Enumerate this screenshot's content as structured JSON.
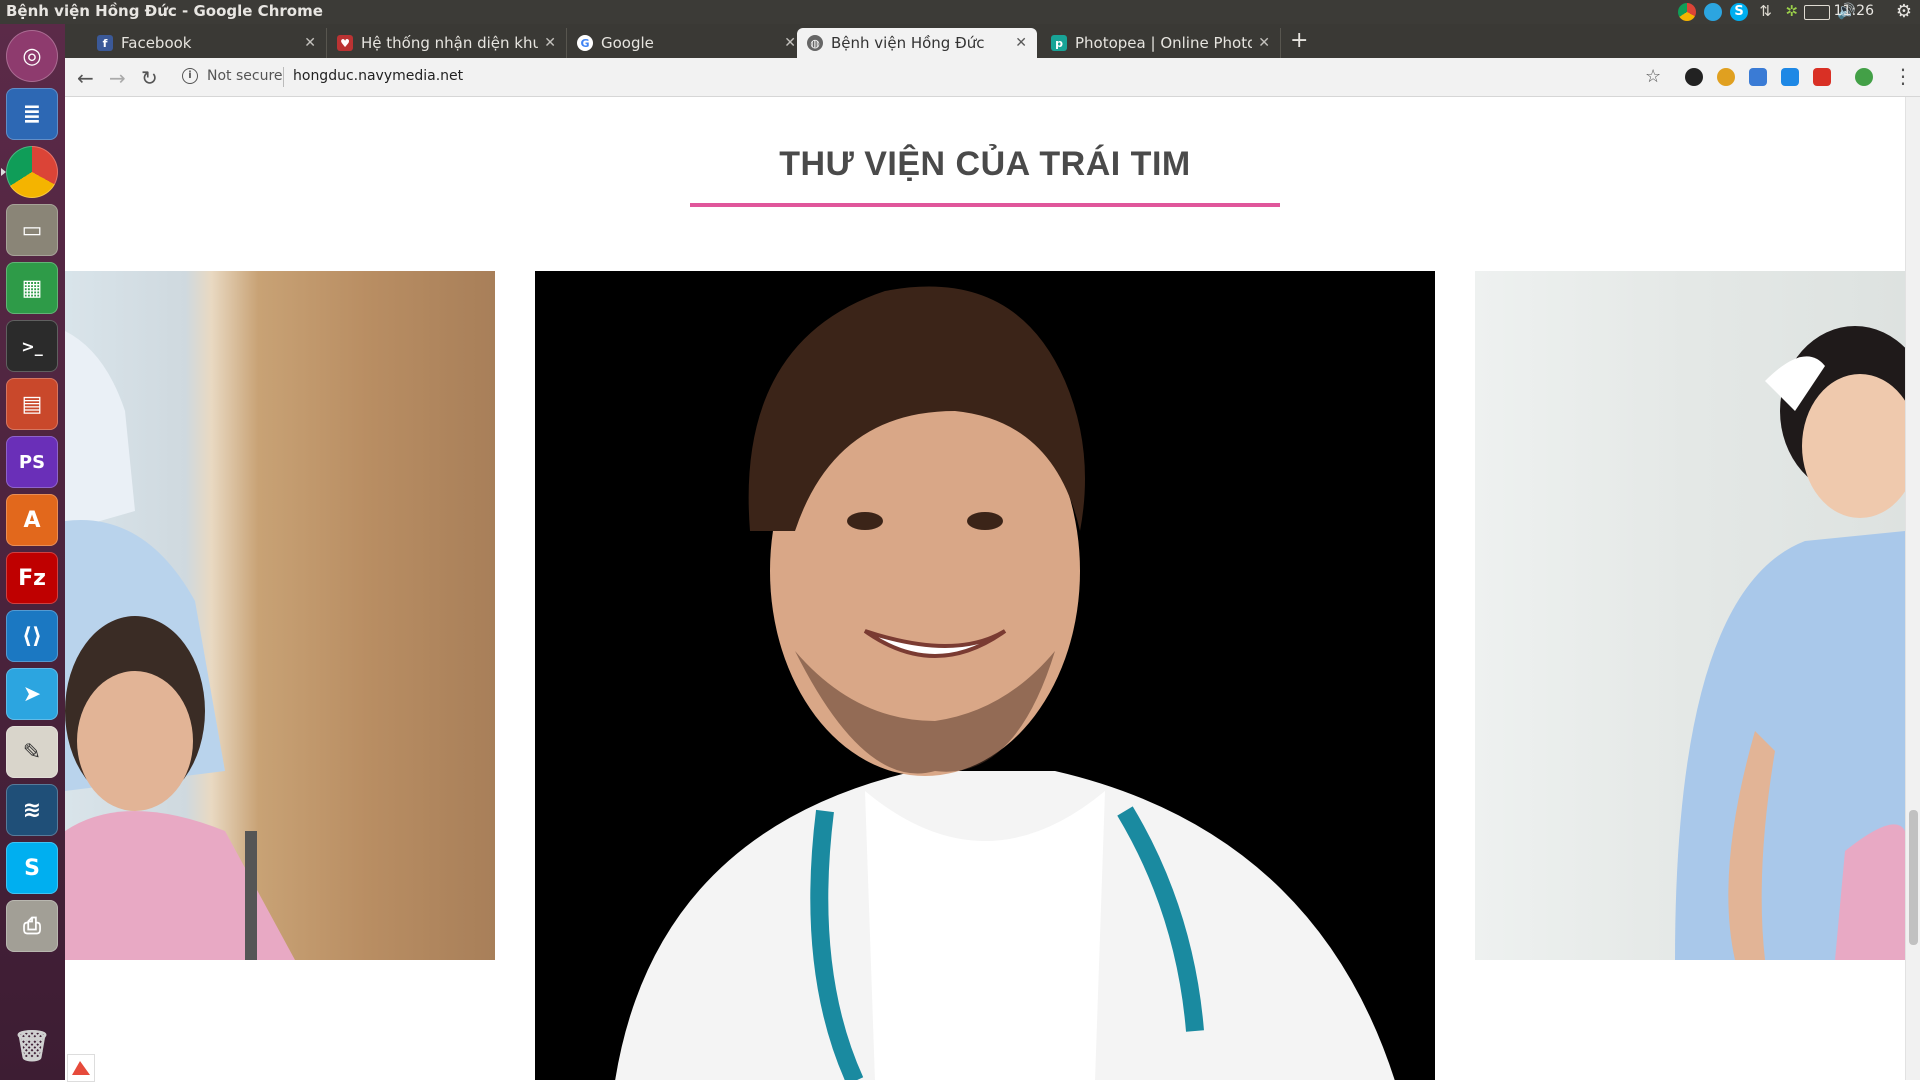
{
  "window": {
    "title": "Bệnh viện Hồng Đức - Google Chrome"
  },
  "system": {
    "clock": "11:26"
  },
  "tabs": [
    {
      "label": "Facebook",
      "favicon": "facebook-icon",
      "active": false
    },
    {
      "label": "Hệ thống nhận diện khu",
      "favicon": "hospital-favicon-icon",
      "active": false
    },
    {
      "label": "Google",
      "favicon": "google-icon",
      "active": false
    },
    {
      "label": "Bệnh viện Hồng Đức",
      "favicon": "globe-icon",
      "active": true
    },
    {
      "label": "Photopea | Online Photo",
      "favicon": "photopea-icon",
      "active": false
    }
  ],
  "toolbar": {
    "security": "Not secure",
    "url": "hongduc.navymedia.net"
  },
  "page": {
    "section_title": "THƯ VIỆN CỦA TRÁI TIM"
  },
  "colors": {
    "title_underline": "#e0569b",
    "title_text": "#4a4a4a",
    "launcher_bg": "#5b2a48"
  }
}
